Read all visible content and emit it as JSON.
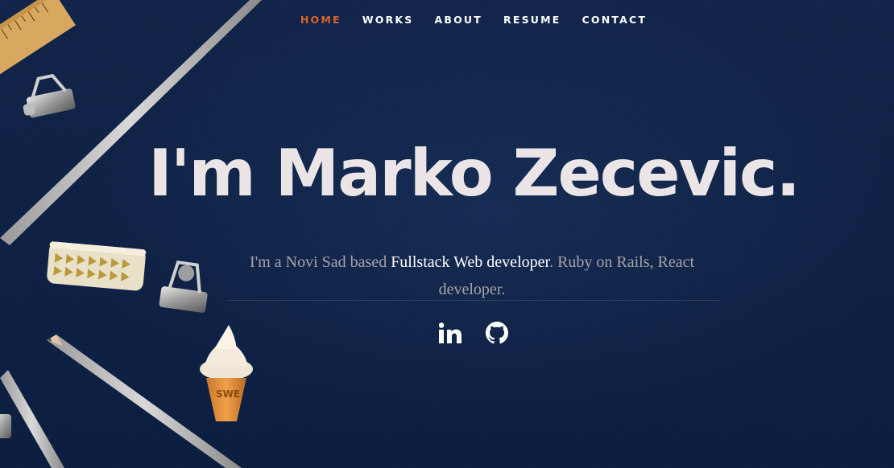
{
  "nav": {
    "items": [
      {
        "label": "HOME",
        "active": true
      },
      {
        "label": "WORKS",
        "active": false
      },
      {
        "label": "ABOUT",
        "active": false
      },
      {
        "label": "RESUME",
        "active": false
      },
      {
        "label": "CONTACT",
        "active": false
      }
    ]
  },
  "hero": {
    "headline": "I'm Marko Zecevic.",
    "intro_prefix": "I'm a Novi Sad based ",
    "intro_highlight": "Fullstack Web developer",
    "intro_suffix": ". Ruby on Rails, React developer."
  },
  "social": [
    {
      "icon": "linkedin-icon"
    },
    {
      "icon": "github-icon"
    }
  ],
  "colors": {
    "background": "#0f2244",
    "accent": "#d9622b",
    "headline": "#ebe5e7",
    "muted_text": "#a7a3a6",
    "highlight_text": "#ffffff"
  }
}
